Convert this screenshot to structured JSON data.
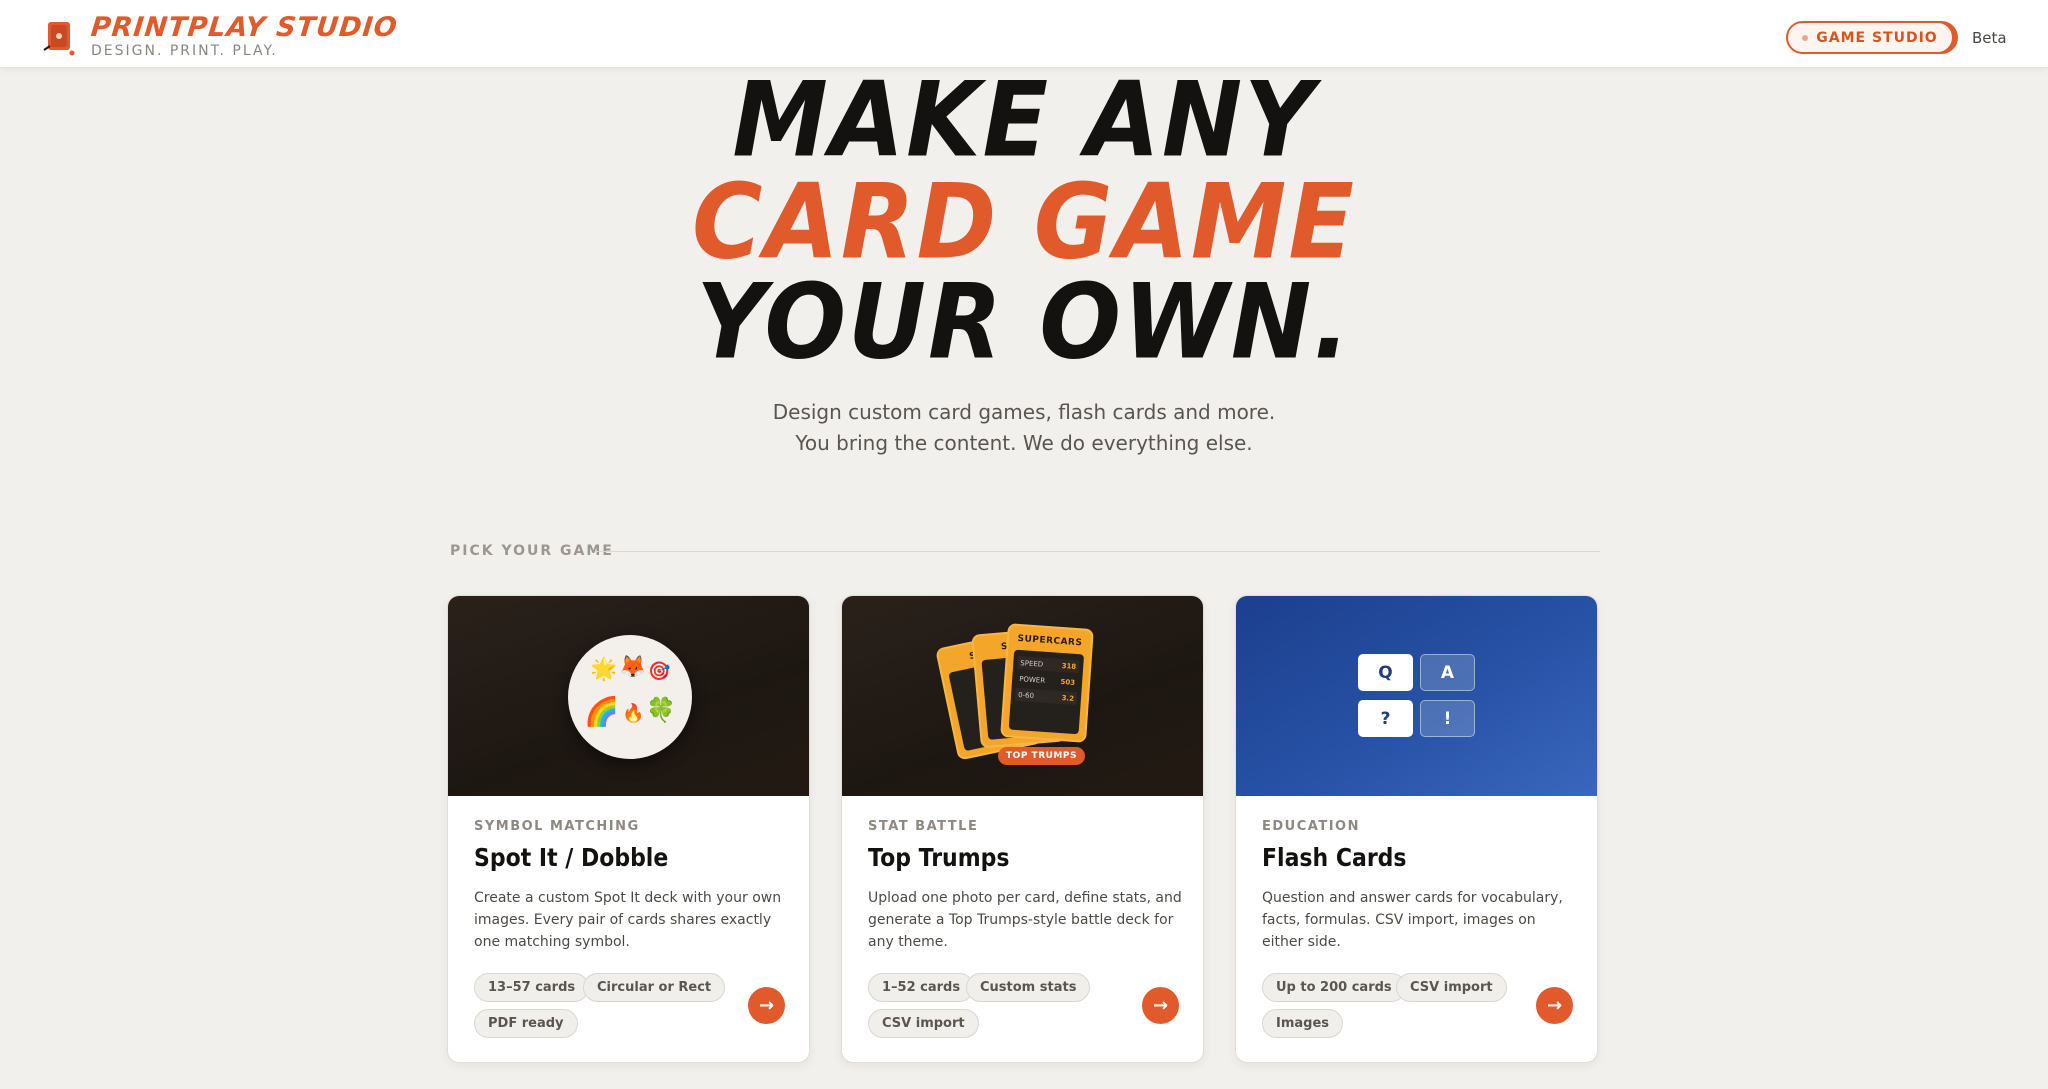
{
  "header": {
    "brand_name": "PRINTPLAY STUDIO",
    "tagline": "DESIGN. PRINT. PLAY.",
    "studio_button": "GAME STUDIO",
    "beta_label": "Beta",
    "accent_color": "#e05a2b"
  },
  "hero": {
    "line1": "MAKE ANY",
    "line2": "CARD GAME",
    "line3": "YOUR OWN.",
    "subtitle_line1": "Design custom card games, flash cards and more.",
    "subtitle_line2": "You bring the content. We do everything else."
  },
  "section": {
    "label": "PICK YOUR GAME"
  },
  "cards": [
    {
      "category": "SYMBOL MATCHING",
      "title": "Spot It / Dobble",
      "description": "Create a custom Spot It deck with your own images. Every pair of cards shares exactly one matching symbol.",
      "chips": [
        "13–57 cards",
        "Circular or Rect",
        "PDF ready"
      ],
      "art": {
        "emojis": [
          "🌟",
          "🦊",
          "🎯",
          "🌈",
          "🔥",
          "🍀"
        ]
      },
      "action_icon": "arrow-right-icon"
    },
    {
      "category": "STAT BATTLE",
      "title": "Top Trumps",
      "description": "Upload one photo per card, define stats, and generate a Top Trumps-style battle deck for any theme.",
      "chips": [
        "1–52 cards",
        "Custom stats",
        "CSV import"
      ],
      "art": {
        "card_title": "SUPERCARS",
        "card_title_short": "SUPE",
        "card_title_shorter": "SUP",
        "stats": [
          {
            "label": "SPEED",
            "value": "318"
          },
          {
            "label": "POWER",
            "value": "503"
          },
          {
            "label": "0-60",
            "value": "3.2"
          }
        ],
        "badge": "TOP TRUMPS"
      },
      "action_icon": "arrow-right-icon"
    },
    {
      "category": "EDUCATION",
      "title": "Flash Cards",
      "description": "Question and answer cards for vocabulary, facts, formulas. CSV import, images on either side.",
      "chips": [
        "Up to 200 cards",
        "CSV import",
        "Images"
      ],
      "art": {
        "tiles": [
          "Q",
          "A",
          "?",
          "!"
        ]
      },
      "action_icon": "arrow-right-icon"
    }
  ]
}
